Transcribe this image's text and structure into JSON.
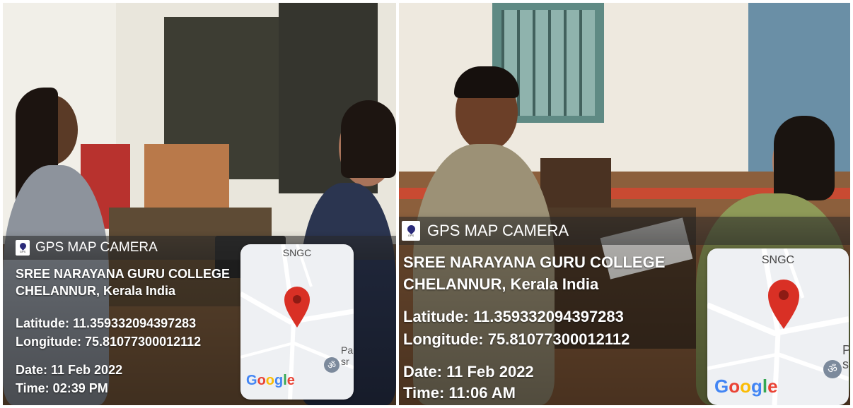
{
  "photos": [
    {
      "gps_header": "GPS MAP CAMERA",
      "address_line1": "SREE NARAYANA GURU COLLEGE",
      "address_line2": "CHELANNUR,  Kerala  India",
      "latitude": "Latitude: 11.359332094397283",
      "longitude": "Longitude: 75.81077300012112",
      "date": "Date: 11 Feb 2022",
      "time": "Time: 02:39 PM",
      "map": {
        "place_label": "SNGC",
        "brand": "Google",
        "poi_icon": "om-icon",
        "poi_text": "Pa\nsr"
      },
      "colors": {
        "pin": "#d93025",
        "overlay": "#282828"
      }
    },
    {
      "gps_header": "GPS MAP CAMERA",
      "address_line1": "SREE NARAYANA GURU COLLEGE",
      "address_line2": "CHELANNUR,  Kerala  India",
      "latitude": "Latitude: 11.359332094397283",
      "longitude": "Longitude: 75.81077300012112",
      "date": "Date: 11 Feb 2022",
      "time": "Time: 11:06 AM",
      "map": {
        "place_label": "SNGC",
        "brand": "Google",
        "poi_icon": "om-icon",
        "poi_text": "P\ns"
      },
      "colors": {
        "pin": "#d93025",
        "overlay": "#282828"
      }
    }
  ]
}
